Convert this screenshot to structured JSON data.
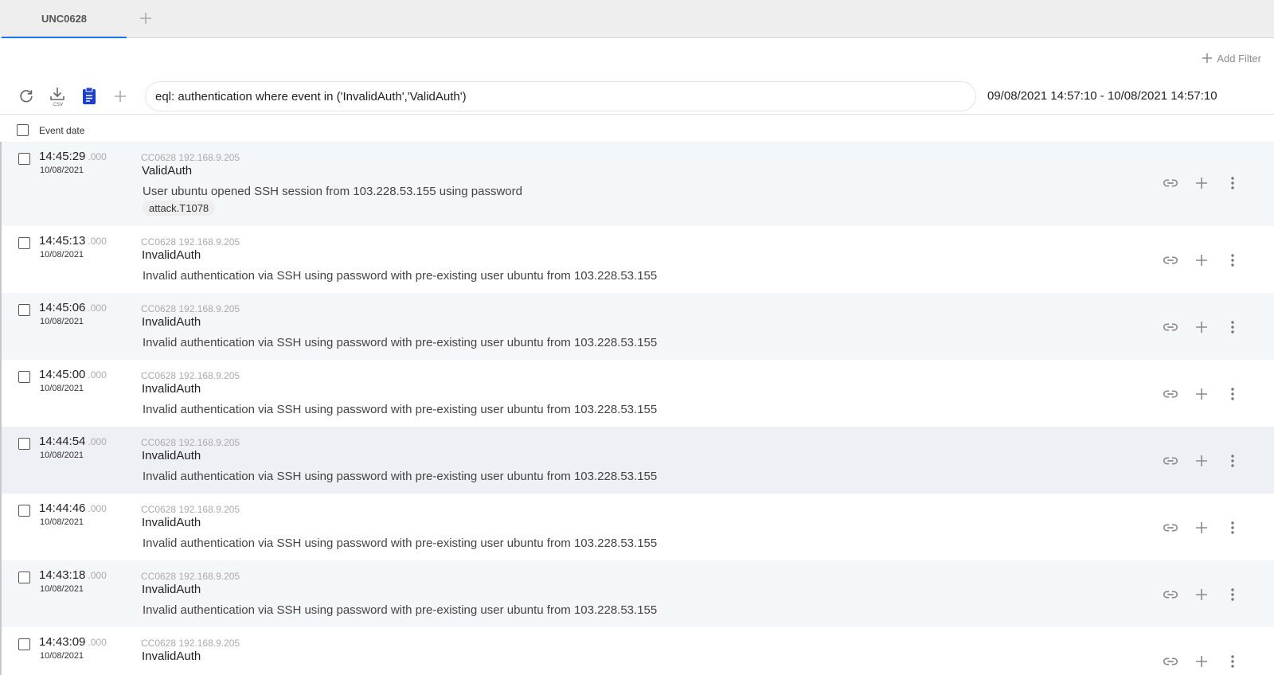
{
  "tabs": [
    {
      "label": "UNC0628",
      "active": true
    }
  ],
  "filters": {
    "add_label": "Add Filter"
  },
  "toolbar": {
    "query": "eql: authentication where event in ('InvalidAuth','ValidAuth')",
    "date_range": "09/08/2021 14:57:10 - 10/08/2021 14:57:10"
  },
  "list": {
    "header_label": "Event date",
    "events": [
      {
        "time": "14:45:29",
        "ms": ".000",
        "date": "10/08/2021",
        "source": "CC0628 192.168.9.205",
        "event": "ValidAuth",
        "description": "User ubuntu opened SSH session from 103.228.53.155 using password",
        "tag": "attack.T1078"
      },
      {
        "time": "14:45:13",
        "ms": ".000",
        "date": "10/08/2021",
        "source": "CC0628 192.168.9.205",
        "event": "InvalidAuth",
        "description": "Invalid authentication via SSH using password with pre-existing user ubuntu from 103.228.53.155"
      },
      {
        "time": "14:45:06",
        "ms": ".000",
        "date": "10/08/2021",
        "source": "CC0628 192.168.9.205",
        "event": "InvalidAuth",
        "description": "Invalid authentication via SSH using password with pre-existing user ubuntu from 103.228.53.155"
      },
      {
        "time": "14:45:00",
        "ms": ".000",
        "date": "10/08/2021",
        "source": "CC0628 192.168.9.205",
        "event": "InvalidAuth",
        "description": "Invalid authentication via SSH using password with pre-existing user ubuntu from 103.228.53.155"
      },
      {
        "time": "14:44:54",
        "ms": ".000",
        "date": "10/08/2021",
        "source": "CC0628 192.168.9.205",
        "event": "InvalidAuth",
        "description": "Invalid authentication via SSH using password with pre-existing user ubuntu from 103.228.53.155"
      },
      {
        "time": "14:44:46",
        "ms": ".000",
        "date": "10/08/2021",
        "source": "CC0628 192.168.9.205",
        "event": "InvalidAuth",
        "description": "Invalid authentication via SSH using password with pre-existing user ubuntu from 103.228.53.155"
      },
      {
        "time": "14:43:18",
        "ms": ".000",
        "date": "10/08/2021",
        "source": "CC0628 192.168.9.205",
        "event": "InvalidAuth",
        "description": "Invalid authentication via SSH using password with pre-existing user ubuntu from 103.228.53.155"
      },
      {
        "time": "14:43:09",
        "ms": ".000",
        "date": "10/08/2021",
        "source": "CC0628 192.168.9.205",
        "event": "InvalidAuth",
        "description": ""
      }
    ]
  },
  "icons": {
    "refresh": "refresh-icon",
    "download_csv": "download-csv-icon",
    "clipboard": "clipboard-icon",
    "add": "plus-icon",
    "link": "link-icon",
    "more": "more-vertical-icon"
  },
  "colors": {
    "accent": "#1a73e8",
    "clipboard": "#1a3fd4",
    "row_alt": "#f3f7fa",
    "row_highlight": "#edf1f6"
  }
}
